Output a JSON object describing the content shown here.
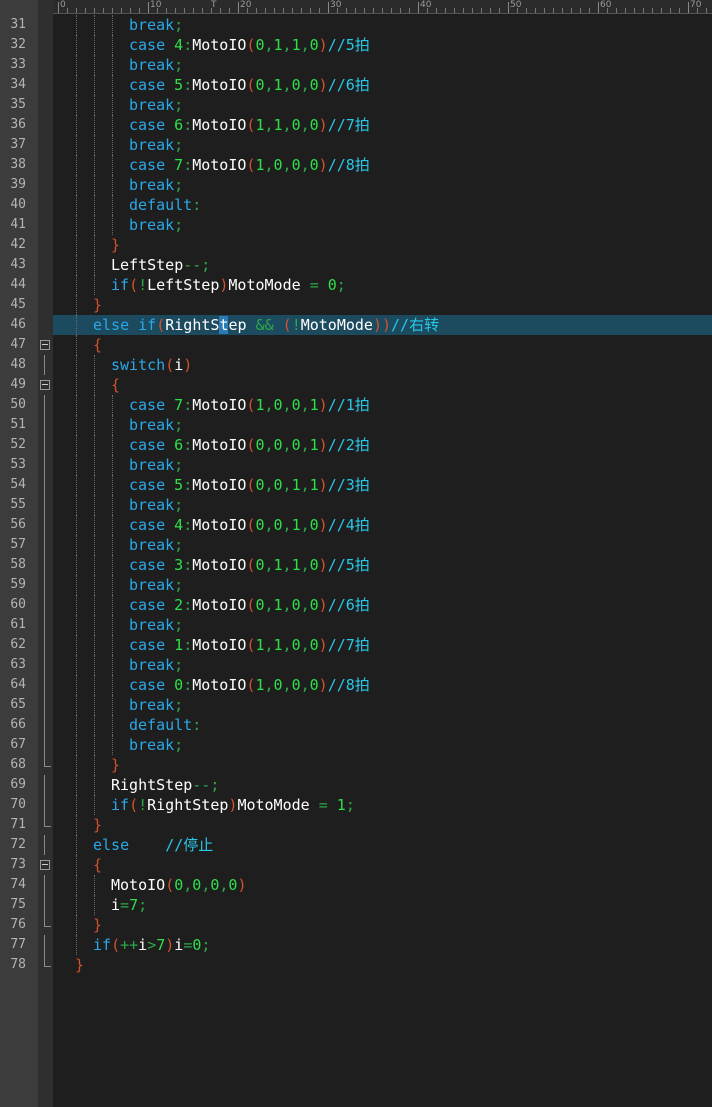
{
  "ruler": {
    "labels": [
      "0",
      "10",
      "20",
      "30",
      "40",
      "50",
      "60",
      "70"
    ],
    "marker": "T"
  },
  "lines": [
    {
      "n": "31",
      "indent": 3,
      "tokens": [
        [
          "kw",
          "break"
        ],
        [
          "op",
          ";"
        ]
      ]
    },
    {
      "n": "32",
      "indent": 3,
      "tokens": [
        [
          "kw",
          "case"
        ],
        [
          "id",
          " "
        ],
        [
          "num",
          "4"
        ],
        [
          "op",
          ":"
        ],
        [
          "id",
          "MotoIO"
        ],
        [
          "br",
          "("
        ],
        [
          "num",
          "0"
        ],
        [
          "op",
          ","
        ],
        [
          "num",
          "1"
        ],
        [
          "op",
          ","
        ],
        [
          "num",
          "1"
        ],
        [
          "op",
          ","
        ],
        [
          "num",
          "0"
        ],
        [
          "br",
          ")"
        ],
        [
          "cm",
          "//5拍"
        ]
      ]
    },
    {
      "n": "33",
      "indent": 3,
      "tokens": [
        [
          "kw",
          "break"
        ],
        [
          "op",
          ";"
        ]
      ]
    },
    {
      "n": "34",
      "indent": 3,
      "tokens": [
        [
          "kw",
          "case"
        ],
        [
          "id",
          " "
        ],
        [
          "num",
          "5"
        ],
        [
          "op",
          ":"
        ],
        [
          "id",
          "MotoIO"
        ],
        [
          "br",
          "("
        ],
        [
          "num",
          "0"
        ],
        [
          "op",
          ","
        ],
        [
          "num",
          "1"
        ],
        [
          "op",
          ","
        ],
        [
          "num",
          "0"
        ],
        [
          "op",
          ","
        ],
        [
          "num",
          "0"
        ],
        [
          "br",
          ")"
        ],
        [
          "cm",
          "//6拍"
        ]
      ]
    },
    {
      "n": "35",
      "indent": 3,
      "tokens": [
        [
          "kw",
          "break"
        ],
        [
          "op",
          ";"
        ]
      ]
    },
    {
      "n": "36",
      "indent": 3,
      "tokens": [
        [
          "kw",
          "case"
        ],
        [
          "id",
          " "
        ],
        [
          "num",
          "6"
        ],
        [
          "op",
          ":"
        ],
        [
          "id",
          "MotoIO"
        ],
        [
          "br",
          "("
        ],
        [
          "num",
          "1"
        ],
        [
          "op",
          ","
        ],
        [
          "num",
          "1"
        ],
        [
          "op",
          ","
        ],
        [
          "num",
          "0"
        ],
        [
          "op",
          ","
        ],
        [
          "num",
          "0"
        ],
        [
          "br",
          ")"
        ],
        [
          "cm",
          "//7拍"
        ]
      ]
    },
    {
      "n": "37",
      "indent": 3,
      "tokens": [
        [
          "kw",
          "break"
        ],
        [
          "op",
          ";"
        ]
      ]
    },
    {
      "n": "38",
      "indent": 3,
      "tokens": [
        [
          "kw",
          "case"
        ],
        [
          "id",
          " "
        ],
        [
          "num",
          "7"
        ],
        [
          "op",
          ":"
        ],
        [
          "id",
          "MotoIO"
        ],
        [
          "br",
          "("
        ],
        [
          "num",
          "1"
        ],
        [
          "op",
          ","
        ],
        [
          "num",
          "0"
        ],
        [
          "op",
          ","
        ],
        [
          "num",
          "0"
        ],
        [
          "op",
          ","
        ],
        [
          "num",
          "0"
        ],
        [
          "br",
          ")"
        ],
        [
          "cm",
          "//8拍"
        ]
      ]
    },
    {
      "n": "39",
      "indent": 3,
      "tokens": [
        [
          "kw",
          "break"
        ],
        [
          "op",
          ";"
        ]
      ]
    },
    {
      "n": "40",
      "indent": 3,
      "tokens": [
        [
          "kw",
          "default"
        ],
        [
          "op",
          ":"
        ]
      ]
    },
    {
      "n": "41",
      "indent": 3,
      "tokens": [
        [
          "kw",
          "break"
        ],
        [
          "op",
          ";"
        ]
      ]
    },
    {
      "n": "42",
      "indent": 2,
      "tokens": [
        [
          "br",
          "}"
        ]
      ]
    },
    {
      "n": "43",
      "indent": 2,
      "tokens": [
        [
          "id",
          "LeftStep"
        ],
        [
          "op",
          "--;"
        ]
      ]
    },
    {
      "n": "44",
      "indent": 2,
      "tokens": [
        [
          "kw",
          "if"
        ],
        [
          "br",
          "("
        ],
        [
          "op",
          "!"
        ],
        [
          "id",
          "LeftStep"
        ],
        [
          "br",
          ")"
        ],
        [
          "id",
          "MotoMode "
        ],
        [
          "op",
          "= "
        ],
        [
          "num",
          "0"
        ],
        [
          "op",
          ";"
        ]
      ]
    },
    {
      "n": "45",
      "indent": 1,
      "tokens": [
        [
          "br",
          "}"
        ]
      ]
    },
    {
      "n": "46",
      "indent": 1,
      "hl": true,
      "tokens": [
        [
          "kw",
          "else if"
        ],
        [
          "br",
          "("
        ],
        [
          "id",
          "RightS"
        ],
        [
          "caret",
          "t"
        ],
        [
          "id",
          "ep "
        ],
        [
          "op",
          "&& "
        ],
        [
          "br",
          "("
        ],
        [
          "op",
          "!"
        ],
        [
          "id",
          "MotoMode"
        ],
        [
          "br",
          "))"
        ],
        [
          "cm",
          "//右转"
        ]
      ]
    },
    {
      "n": "47",
      "indent": 1,
      "fold": "box",
      "tokens": [
        [
          "br",
          "{"
        ]
      ]
    },
    {
      "n": "48",
      "indent": 2,
      "fold": "line",
      "tokens": [
        [
          "kw",
          "switch"
        ],
        [
          "br",
          "("
        ],
        [
          "id",
          "i"
        ],
        [
          "br",
          ")"
        ]
      ]
    },
    {
      "n": "49",
      "indent": 2,
      "fold": "box",
      "tokens": [
        [
          "br",
          "{"
        ]
      ]
    },
    {
      "n": "50",
      "indent": 3,
      "fold": "line",
      "tokens": [
        [
          "kw",
          "case"
        ],
        [
          "id",
          " "
        ],
        [
          "num",
          "7"
        ],
        [
          "op",
          ":"
        ],
        [
          "id",
          "MotoIO"
        ],
        [
          "br",
          "("
        ],
        [
          "num",
          "1"
        ],
        [
          "op",
          ","
        ],
        [
          "num",
          "0"
        ],
        [
          "op",
          ","
        ],
        [
          "num",
          "0"
        ],
        [
          "op",
          ","
        ],
        [
          "num",
          "1"
        ],
        [
          "br",
          ")"
        ],
        [
          "cm",
          "//1拍"
        ]
      ]
    },
    {
      "n": "51",
      "indent": 3,
      "fold": "line",
      "tokens": [
        [
          "kw",
          "break"
        ],
        [
          "op",
          ";"
        ]
      ]
    },
    {
      "n": "52",
      "indent": 3,
      "fold": "line",
      "tokens": [
        [
          "kw",
          "case"
        ],
        [
          "id",
          " "
        ],
        [
          "num",
          "6"
        ],
        [
          "op",
          ":"
        ],
        [
          "id",
          "MotoIO"
        ],
        [
          "br",
          "("
        ],
        [
          "num",
          "0"
        ],
        [
          "op",
          ","
        ],
        [
          "num",
          "0"
        ],
        [
          "op",
          ","
        ],
        [
          "num",
          "0"
        ],
        [
          "op",
          ","
        ],
        [
          "num",
          "1"
        ],
        [
          "br",
          ")"
        ],
        [
          "cm",
          "//2拍"
        ]
      ]
    },
    {
      "n": "53",
      "indent": 3,
      "fold": "line",
      "tokens": [
        [
          "kw",
          "break"
        ],
        [
          "op",
          ";"
        ]
      ]
    },
    {
      "n": "54",
      "indent": 3,
      "fold": "line",
      "tokens": [
        [
          "kw",
          "case"
        ],
        [
          "id",
          " "
        ],
        [
          "num",
          "5"
        ],
        [
          "op",
          ":"
        ],
        [
          "id",
          "MotoIO"
        ],
        [
          "br",
          "("
        ],
        [
          "num",
          "0"
        ],
        [
          "op",
          ","
        ],
        [
          "num",
          "0"
        ],
        [
          "op",
          ","
        ],
        [
          "num",
          "1"
        ],
        [
          "op",
          ","
        ],
        [
          "num",
          "1"
        ],
        [
          "br",
          ")"
        ],
        [
          "cm",
          "//3拍"
        ]
      ]
    },
    {
      "n": "55",
      "indent": 3,
      "fold": "line",
      "tokens": [
        [
          "kw",
          "break"
        ],
        [
          "op",
          ";"
        ]
      ]
    },
    {
      "n": "56",
      "indent": 3,
      "fold": "line",
      "tokens": [
        [
          "kw",
          "case"
        ],
        [
          "id",
          " "
        ],
        [
          "num",
          "4"
        ],
        [
          "op",
          ":"
        ],
        [
          "id",
          "MotoIO"
        ],
        [
          "br",
          "("
        ],
        [
          "num",
          "0"
        ],
        [
          "op",
          ","
        ],
        [
          "num",
          "0"
        ],
        [
          "op",
          ","
        ],
        [
          "num",
          "1"
        ],
        [
          "op",
          ","
        ],
        [
          "num",
          "0"
        ],
        [
          "br",
          ")"
        ],
        [
          "cm",
          "//4拍"
        ]
      ]
    },
    {
      "n": "57",
      "indent": 3,
      "fold": "line",
      "tokens": [
        [
          "kw",
          "break"
        ],
        [
          "op",
          ";"
        ]
      ]
    },
    {
      "n": "58",
      "indent": 3,
      "fold": "line",
      "tokens": [
        [
          "kw",
          "case"
        ],
        [
          "id",
          " "
        ],
        [
          "num",
          "3"
        ],
        [
          "op",
          ":"
        ],
        [
          "id",
          "MotoIO"
        ],
        [
          "br",
          "("
        ],
        [
          "num",
          "0"
        ],
        [
          "op",
          ","
        ],
        [
          "num",
          "1"
        ],
        [
          "op",
          ","
        ],
        [
          "num",
          "1"
        ],
        [
          "op",
          ","
        ],
        [
          "num",
          "0"
        ],
        [
          "br",
          ")"
        ],
        [
          "cm",
          "//5拍"
        ]
      ]
    },
    {
      "n": "59",
      "indent": 3,
      "fold": "line",
      "tokens": [
        [
          "kw",
          "break"
        ],
        [
          "op",
          ";"
        ]
      ]
    },
    {
      "n": "60",
      "indent": 3,
      "fold": "line",
      "tokens": [
        [
          "kw",
          "case"
        ],
        [
          "id",
          " "
        ],
        [
          "num",
          "2"
        ],
        [
          "op",
          ":"
        ],
        [
          "id",
          "MotoIO"
        ],
        [
          "br",
          "("
        ],
        [
          "num",
          "0"
        ],
        [
          "op",
          ","
        ],
        [
          "num",
          "1"
        ],
        [
          "op",
          ","
        ],
        [
          "num",
          "0"
        ],
        [
          "op",
          ","
        ],
        [
          "num",
          "0"
        ],
        [
          "br",
          ")"
        ],
        [
          "cm",
          "//6拍"
        ]
      ]
    },
    {
      "n": "61",
      "indent": 3,
      "fold": "line",
      "tokens": [
        [
          "kw",
          "break"
        ],
        [
          "op",
          ";"
        ]
      ]
    },
    {
      "n": "62",
      "indent": 3,
      "fold": "line",
      "tokens": [
        [
          "kw",
          "case"
        ],
        [
          "id",
          " "
        ],
        [
          "num",
          "1"
        ],
        [
          "op",
          ":"
        ],
        [
          "id",
          "MotoIO"
        ],
        [
          "br",
          "("
        ],
        [
          "num",
          "1"
        ],
        [
          "op",
          ","
        ],
        [
          "num",
          "1"
        ],
        [
          "op",
          ","
        ],
        [
          "num",
          "0"
        ],
        [
          "op",
          ","
        ],
        [
          "num",
          "0"
        ],
        [
          "br",
          ")"
        ],
        [
          "cm",
          "//7拍"
        ]
      ]
    },
    {
      "n": "63",
      "indent": 3,
      "fold": "line",
      "tokens": [
        [
          "kw",
          "break"
        ],
        [
          "op",
          ";"
        ]
      ]
    },
    {
      "n": "64",
      "indent": 3,
      "fold": "line",
      "tokens": [
        [
          "kw",
          "case"
        ],
        [
          "id",
          " "
        ],
        [
          "num",
          "0"
        ],
        [
          "op",
          ":"
        ],
        [
          "id",
          "MotoIO"
        ],
        [
          "br",
          "("
        ],
        [
          "num",
          "1"
        ],
        [
          "op",
          ","
        ],
        [
          "num",
          "0"
        ],
        [
          "op",
          ","
        ],
        [
          "num",
          "0"
        ],
        [
          "op",
          ","
        ],
        [
          "num",
          "0"
        ],
        [
          "br",
          ")"
        ],
        [
          "cm",
          "//8拍"
        ]
      ]
    },
    {
      "n": "65",
      "indent": 3,
      "fold": "line",
      "tokens": [
        [
          "kw",
          "break"
        ],
        [
          "op",
          ";"
        ]
      ]
    },
    {
      "n": "66",
      "indent": 3,
      "fold": "line",
      "tokens": [
        [
          "kw",
          "default"
        ],
        [
          "op",
          ":"
        ]
      ]
    },
    {
      "n": "67",
      "indent": 3,
      "fold": "line",
      "tokens": [
        [
          "kw",
          "break"
        ],
        [
          "op",
          ";"
        ]
      ]
    },
    {
      "n": "68",
      "indent": 2,
      "fold": "end",
      "tokens": [
        [
          "br",
          "}"
        ]
      ]
    },
    {
      "n": "69",
      "indent": 2,
      "fold": "line",
      "tokens": [
        [
          "id",
          "RightStep"
        ],
        [
          "op",
          "--;"
        ]
      ]
    },
    {
      "n": "70",
      "indent": 2,
      "fold": "line",
      "tokens": [
        [
          "kw",
          "if"
        ],
        [
          "br",
          "("
        ],
        [
          "op",
          "!"
        ],
        [
          "id",
          "RightStep"
        ],
        [
          "br",
          ")"
        ],
        [
          "id",
          "MotoMode "
        ],
        [
          "op",
          "= "
        ],
        [
          "num",
          "1"
        ],
        [
          "op",
          ";"
        ]
      ]
    },
    {
      "n": "71",
      "indent": 1,
      "fold": "end",
      "tokens": [
        [
          "br",
          "}"
        ]
      ]
    },
    {
      "n": "72",
      "indent": 1,
      "fold": "line",
      "tokens": [
        [
          "kw",
          "else"
        ],
        [
          "id",
          "    "
        ],
        [
          "cm",
          "//停止"
        ]
      ]
    },
    {
      "n": "73",
      "indent": 1,
      "fold": "box",
      "tokens": [
        [
          "br",
          "{"
        ]
      ]
    },
    {
      "n": "74",
      "indent": 2,
      "fold": "line",
      "tokens": [
        [
          "id",
          "MotoIO"
        ],
        [
          "br",
          "("
        ],
        [
          "num",
          "0"
        ],
        [
          "op",
          ","
        ],
        [
          "num",
          "0"
        ],
        [
          "op",
          ","
        ],
        [
          "num",
          "0"
        ],
        [
          "op",
          ","
        ],
        [
          "num",
          "0"
        ],
        [
          "br",
          ")"
        ]
      ]
    },
    {
      "n": "75",
      "indent": 2,
      "fold": "line",
      "tokens": [
        [
          "id",
          "i"
        ],
        [
          "op",
          "="
        ],
        [
          "num",
          "7"
        ],
        [
          "op",
          ";"
        ]
      ]
    },
    {
      "n": "76",
      "indent": 1,
      "fold": "end",
      "tokens": [
        [
          "br",
          "}"
        ]
      ]
    },
    {
      "n": "77",
      "indent": 1,
      "fold": "line",
      "tokens": [
        [
          "kw",
          "if"
        ],
        [
          "br",
          "("
        ],
        [
          "op",
          "++"
        ],
        [
          "id",
          "i"
        ],
        [
          "op",
          ">"
        ],
        [
          "num",
          "7"
        ],
        [
          "br",
          ")"
        ],
        [
          "id",
          "i"
        ],
        [
          "op",
          "="
        ],
        [
          "num",
          "0"
        ],
        [
          "op",
          ";"
        ]
      ]
    },
    {
      "n": "78",
      "indent": 0,
      "fold": "end",
      "tokens": [
        [
          "br",
          "}"
        ]
      ]
    }
  ]
}
